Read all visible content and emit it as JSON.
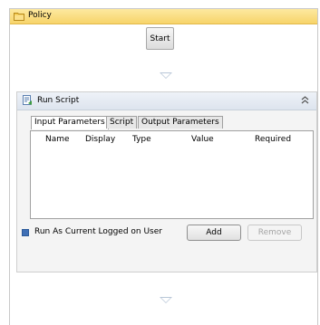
{
  "policy": {
    "title": "Policy"
  },
  "flow": {
    "start_label": "Start"
  },
  "run_script": {
    "title": "Run Script",
    "tabs": [
      {
        "label": "Input Parameters",
        "active": true
      },
      {
        "label": "Script",
        "active": false
      },
      {
        "label": "Output Parameters",
        "active": false
      }
    ],
    "columns": [
      "Name",
      "Display",
      "Type",
      "Value",
      "Required"
    ],
    "run_as_label": "Run As Current Logged on User",
    "run_as_checked": true,
    "add_label": "Add",
    "remove_label": "Remove"
  }
}
